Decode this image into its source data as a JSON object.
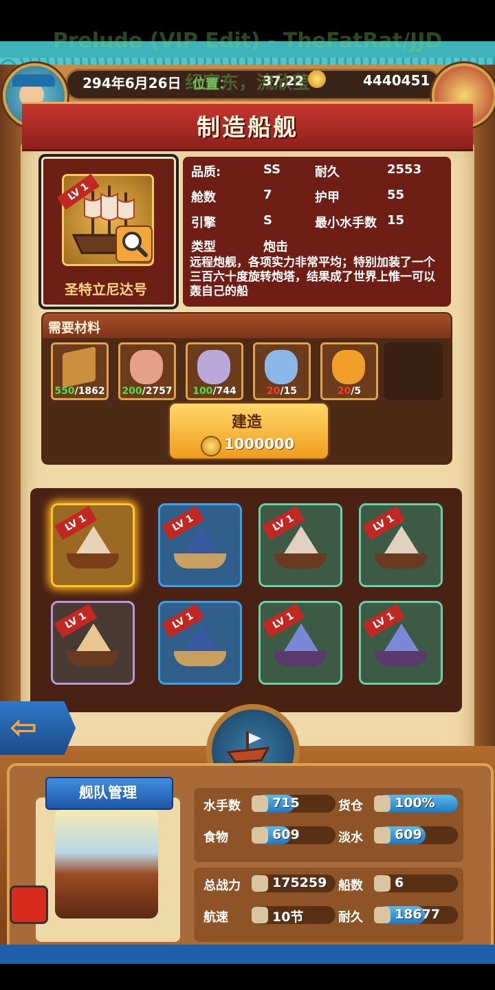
{
  "overlay": {
    "song_title": "Prelude (VIP Edit) - TheFatRat/JJD",
    "song_sub": "纪宣东，流欣莹"
  },
  "header": {
    "date": "294年6月26日",
    "location": "位置：",
    "coords": "37,22",
    "gold": "4440451"
  },
  "page": {
    "title": "制造船舰"
  },
  "ship": {
    "level": "LV 1",
    "name": "圣特立尼达号",
    "stats": [
      {
        "label": "品质:",
        "value": "SS"
      },
      {
        "label": "耐久",
        "value": "2553"
      },
      {
        "label": "舱数",
        "value": "7"
      },
      {
        "label": "护甲",
        "value": "55"
      },
      {
        "label": "引擎",
        "value": "S"
      },
      {
        "label": "最小水手数",
        "value": "15"
      },
      {
        "label": "类型",
        "value": "炮击"
      }
    ],
    "description": "远程炮舰，各项实力非常平均；特别加装了一个三百六十度旋转炮塔，结果成了世界上惟一可以轰自己的船"
  },
  "materials": {
    "title": "需要材料",
    "items": [
      {
        "icon": "wood-icon",
        "have": "550",
        "need": "/1862",
        "ok": true,
        "color": "#c9913f"
      },
      {
        "icon": "pink-gem-icon",
        "have": "200",
        "need": "/2757",
        "ok": true,
        "color": "#e4a08a"
      },
      {
        "icon": "purple-gem-icon",
        "have": "100",
        "need": "/744",
        "ok": true,
        "color": "#b9a8d8"
      },
      {
        "icon": "blue-gem-icon",
        "have": "20",
        "need": "/15",
        "ok": false,
        "color": "#8ab8e8"
      },
      {
        "icon": "gold-gem-icon",
        "have": "20",
        "need": "/5",
        "ok": false,
        "color": "#f0a028"
      }
    ]
  },
  "build": {
    "label": "建造",
    "cost": "1000000"
  },
  "ships_grid": [
    {
      "level": "LV 1",
      "border": "#ffc52a",
      "bg": "#9a6a24",
      "hull": "#7a3e18",
      "sail": "#e8d2b8",
      "selected": true
    },
    {
      "level": "LV 1",
      "border": "#3aa0e8",
      "bg": "#2f5f8a",
      "hull": "#c8a060",
      "sail": "#3a5aa0",
      "selected": false
    },
    {
      "level": "LV 1",
      "border": "#6ad0a8",
      "bg": "#3c5a44",
      "hull": "#6a3a20",
      "sail": "#e0d0c0",
      "selected": false
    },
    {
      "level": "LV 1",
      "border": "#6ad0a8",
      "bg": "#3c5a44",
      "hull": "#6a3a20",
      "sail": "#e0d0c0",
      "selected": false
    },
    {
      "level": "LV 1",
      "border": "#b89ad8",
      "bg": "#4a3a34",
      "hull": "#6a3a20",
      "sail": "#e8c890",
      "selected": false
    },
    {
      "level": "LV 1",
      "border": "#3aa0e8",
      "bg": "#2f5f8a",
      "hull": "#c8a060",
      "sail": "#3a5aa0",
      "selected": false
    },
    {
      "level": "LV 1",
      "border": "#6ad0a8",
      "bg": "#3c5a44",
      "hull": "#5a3a6a",
      "sail": "#7a88d8",
      "selected": false
    },
    {
      "level": "LV 1",
      "border": "#6ad0a8",
      "bg": "#3c5a44",
      "hull": "#5a3a6a",
      "sail": "#7a88d8",
      "selected": false
    }
  ],
  "fleet": {
    "title": "舰队管理",
    "rows1": [
      {
        "label": "水手数",
        "value": "715",
        "fill": 0.5,
        "icon": "sailor-icon"
      },
      {
        "label": "货仓",
        "value": "100%",
        "fill": 1.0,
        "icon": "cargo-icon"
      },
      {
        "label": "食物",
        "value": "609",
        "fill": 0.45,
        "icon": "meat-icon"
      },
      {
        "label": "淡水",
        "value": "609",
        "fill": 0.6,
        "icon": "water-icon"
      }
    ],
    "rows2": [
      {
        "label": "总战力",
        "value": "175259",
        "fill": 0.0,
        "icon": "swords-icon"
      },
      {
        "label": "船数",
        "value": "6",
        "fill": 0.0,
        "icon": "ship-count-icon"
      },
      {
        "label": "航速",
        "value": "10节",
        "fill": 0.0,
        "icon": "speed-icon"
      },
      {
        "label": "耐久",
        "value": "18677",
        "fill": 0.6,
        "icon": "durability-icon"
      }
    ]
  },
  "colors": {
    "accent": "#c5372f",
    "parchment": "#f0d9a8",
    "wood": "#a8672f",
    "blue_bar": "#1f79c2"
  }
}
